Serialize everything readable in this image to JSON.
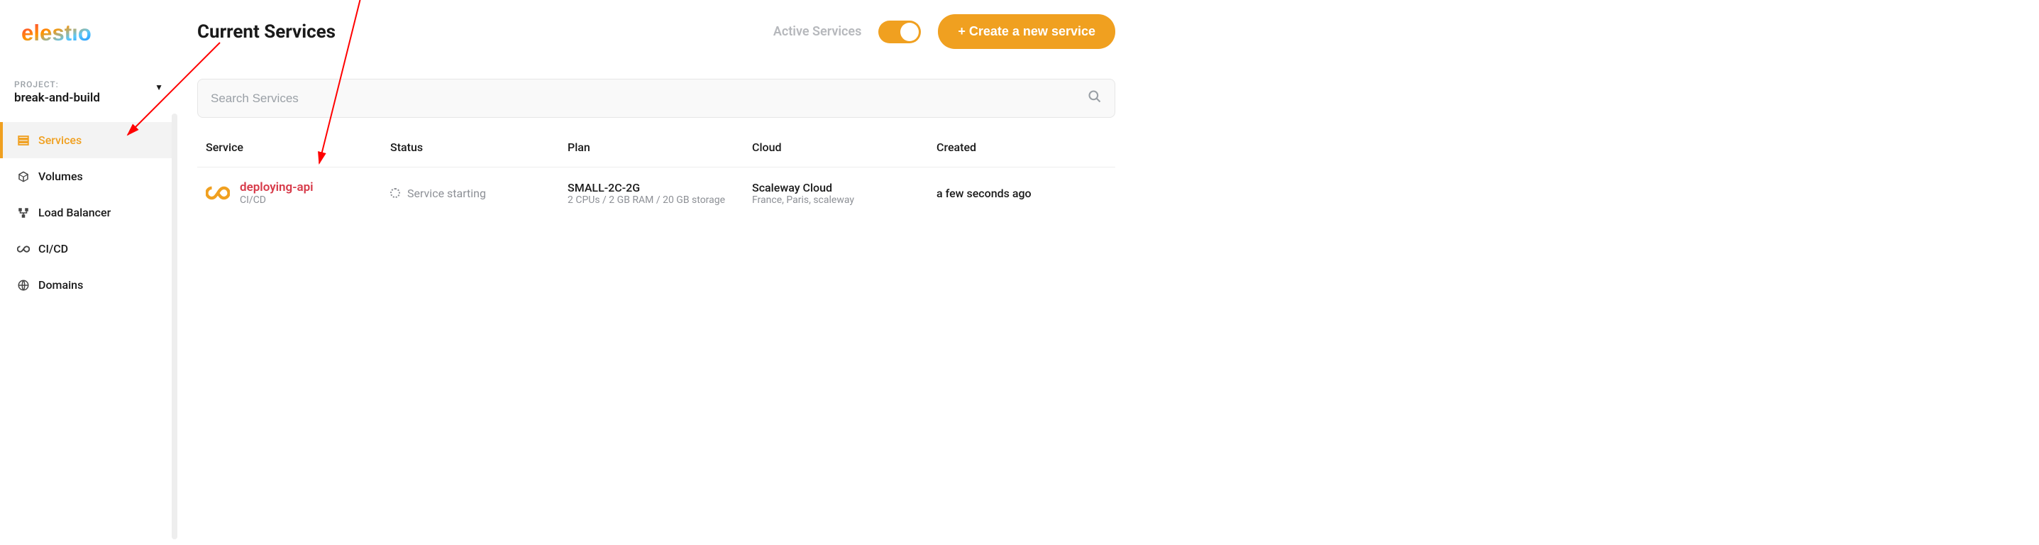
{
  "brand": "elestio",
  "project": {
    "label": "PROJECT:",
    "name": "break-and-build"
  },
  "sidebar": {
    "items": [
      {
        "label": "Services",
        "icon": "server-icon"
      },
      {
        "label": "Volumes",
        "icon": "cube-icon"
      },
      {
        "label": "Load Balancer",
        "icon": "network-icon"
      },
      {
        "label": "CI/CD",
        "icon": "infinity-icon"
      },
      {
        "label": "Domains",
        "icon": "globe-icon"
      }
    ]
  },
  "header": {
    "title": "Current Services",
    "toggle_label": "Active Services",
    "create_label": "+ Create a new service"
  },
  "search": {
    "placeholder": "Search Services"
  },
  "table": {
    "columns": {
      "service": "Service",
      "status": "Status",
      "plan": "Plan",
      "cloud": "Cloud",
      "created": "Created"
    },
    "rows": [
      {
        "name": "deploying-api",
        "subtitle": "CI/CD",
        "icon": "infinity-icon",
        "status": "Service starting",
        "plan_name": "SMALL-2C-2G",
        "plan_spec": "2 CPUs / 2 GB RAM / 20 GB storage",
        "cloud_name": "Scaleway Cloud",
        "cloud_loc": "France, Paris, scaleway",
        "created": "a few seconds ago"
      }
    ]
  },
  "colors": {
    "accent": "#f0a020",
    "danger": "#d73a49"
  }
}
